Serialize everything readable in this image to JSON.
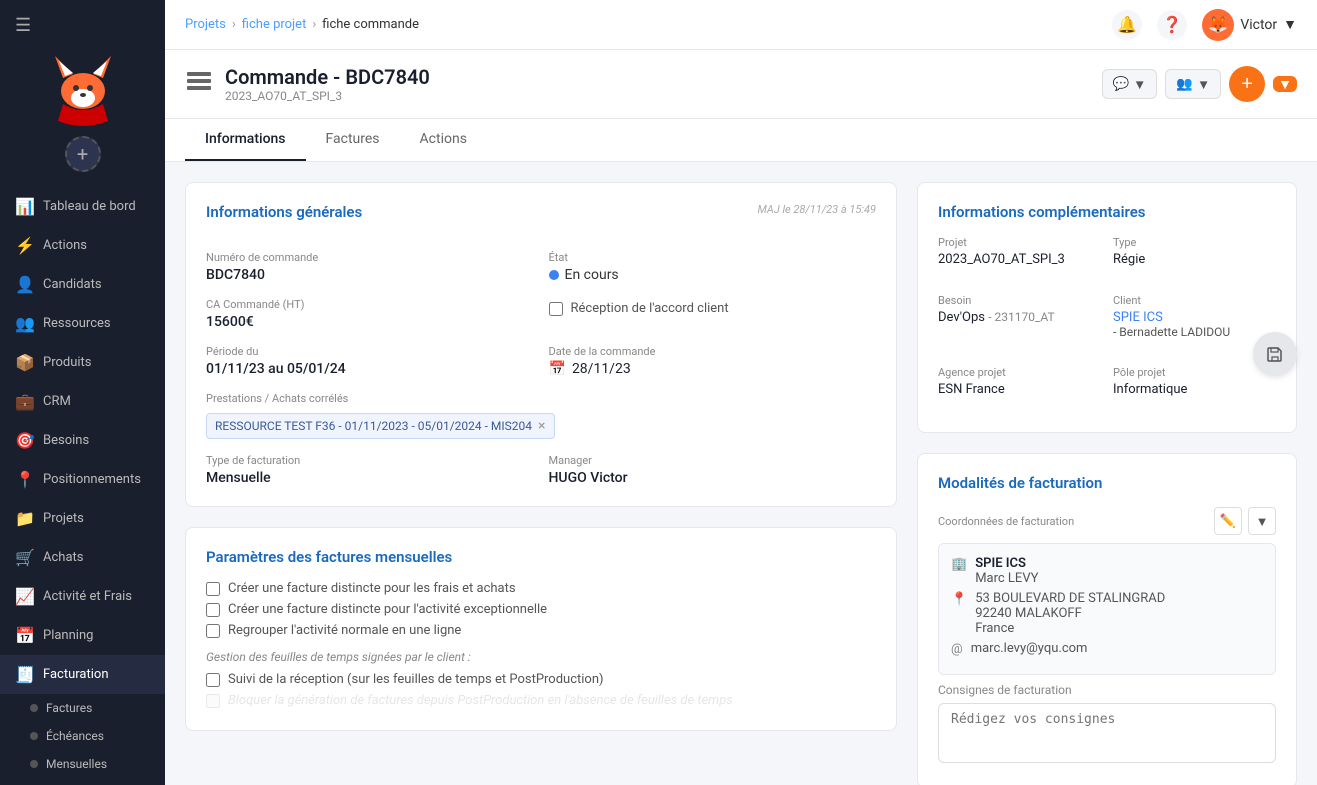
{
  "sidebar": {
    "nav_items": [
      {
        "id": "tableau-de-bord",
        "label": "Tableau de bord",
        "icon": "📊"
      },
      {
        "id": "actions",
        "label": "Actions",
        "icon": "⚡"
      },
      {
        "id": "candidats",
        "label": "Candidats",
        "icon": "👤"
      },
      {
        "id": "ressources",
        "label": "Ressources",
        "icon": "👥"
      },
      {
        "id": "produits",
        "label": "Produits",
        "icon": "📦"
      },
      {
        "id": "crm",
        "label": "CRM",
        "icon": "💼"
      },
      {
        "id": "besoins",
        "label": "Besoins",
        "icon": "🎯"
      },
      {
        "id": "positionnements",
        "label": "Positionnements",
        "icon": "📍"
      },
      {
        "id": "projets",
        "label": "Projets",
        "icon": "📁"
      },
      {
        "id": "achats",
        "label": "Achats",
        "icon": "🛒"
      },
      {
        "id": "activite-et-frais",
        "label": "Activité et Frais",
        "icon": "📈"
      },
      {
        "id": "planning",
        "label": "Planning",
        "icon": "📅"
      },
      {
        "id": "facturation",
        "label": "Facturation",
        "icon": "🧾",
        "active": true
      }
    ],
    "sub_items": [
      {
        "id": "factures",
        "label": "Factures",
        "active": false
      },
      {
        "id": "echeances",
        "label": "Échéances",
        "active": false
      },
      {
        "id": "mensuelles",
        "label": "Mensuelles",
        "active": false
      }
    ]
  },
  "topbar": {
    "breadcrumb": {
      "items": [
        "Projets",
        "fiche projet",
        "fiche commande"
      ]
    },
    "user": {
      "name": "Victor",
      "avatar_emoji": "🦊"
    }
  },
  "page": {
    "title": "Commande - BDC7840",
    "subtitle": "2023_AO70_AT_SPI_3",
    "tabs": [
      {
        "id": "informations",
        "label": "Informations",
        "active": true
      },
      {
        "id": "factures",
        "label": "Factures",
        "active": false
      },
      {
        "id": "actions",
        "label": "Actions",
        "active": false
      }
    ]
  },
  "info_generale": {
    "section_title": "Informations générales",
    "update_text": "MAJ le 28/11/23 à 15:49",
    "numero_commande_label": "Numéro de commande",
    "numero_commande_value": "BDC7840",
    "etat_label": "État",
    "etat_value": "En cours",
    "ca_label": "CA Commandé (HT)",
    "ca_value": "15600€",
    "reception_label": "Réception de l'accord client",
    "periode_label": "Période du",
    "periode_value": "01/11/23 au 05/01/24",
    "date_commande_label": "Date de la commande",
    "date_commande_value": "28/11/23",
    "prestations_label": "Prestations / Achats corrélés",
    "prestation_tag": "RESSOURCE TEST F36 - 01/11/2023 - 05/01/2024 - MIS204",
    "type_facturation_label": "Type de facturation",
    "type_facturation_value": "Mensuelle",
    "manager_label": "Manager",
    "manager_value": "HUGO Victor"
  },
  "params": {
    "section_title": "Paramètres des factures mensuelles",
    "checkbox1": "Créer une facture distincte pour les frais et achats",
    "checkbox2": "Créer une facture distincte pour l'activité exceptionnelle",
    "checkbox3": "Regrouper l'activité normale en une ligne",
    "gestion_label": "Gestion des feuilles de temps signées par le client :",
    "checkbox4": "Suivi de la réception (sur les feuilles de temps et PostProduction)",
    "checkbox5_disabled": "Bloquer la génération de factures depuis PostProduction en l'absence de feuilles de temps"
  },
  "info_complementaires": {
    "section_title": "Informations complémentaires",
    "projet_label": "Projet",
    "projet_value": "2023_AO70_AT_SPI_3",
    "type_label": "Type",
    "type_value": "Régie",
    "besoin_label": "Besoin",
    "besoin_value": "Dev'Ops",
    "besoin_ref": "- 231170_AT",
    "client_label": "Client",
    "client_value": "SPIE ICS",
    "client_contact": "- Bernadette LADIDOU",
    "agence_label": "Agence projet",
    "agence_value": "ESN France",
    "pole_label": "Pôle projet",
    "pole_value": "Informatique"
  },
  "modalites": {
    "section_title": "Modalités de facturation",
    "coords_label": "Coordonnées de facturation",
    "company": "SPIE ICS",
    "contact": "Marc LEVY",
    "address_line1": "53 BOULEVARD DE STALINGRAD",
    "address_line2": "92240 MALAKOFF",
    "country": "France",
    "email": "marc.levy@yqu.com",
    "consignes_label": "Consignes de facturation",
    "consignes_placeholder": "Rédigez vos consignes"
  }
}
